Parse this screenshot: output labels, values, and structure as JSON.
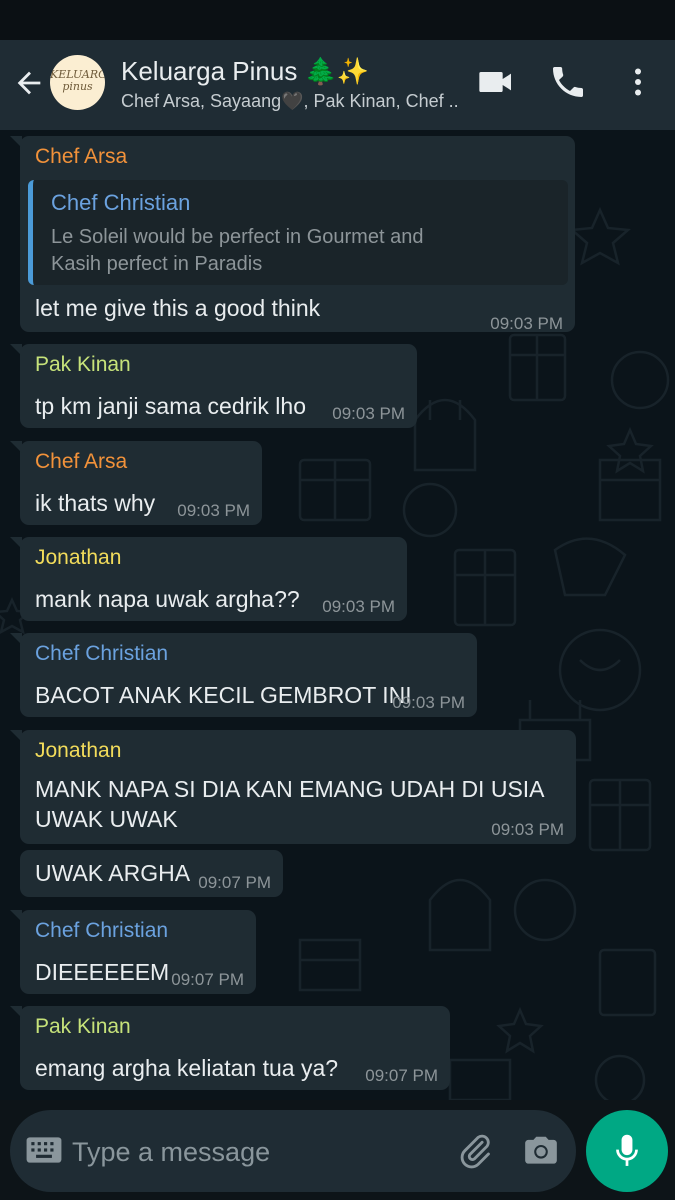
{
  "header": {
    "title": "Keluarga Pinus 🌲✨",
    "subtitle": "Chef Arsa, Sayaang🖤, Pak Kinan, Chef ..",
    "avatar_text": "KELUARGA pinus",
    "back_icon": "arrow-left-icon",
    "video_icon": "video-call-icon",
    "call_icon": "phone-icon",
    "menu_icon": "more-vert-icon"
  },
  "colors": {
    "header_bg": "#1f2c34",
    "chat_bg": "#0b141a",
    "bubble_bg": "#1f2c33",
    "accent": "#00a884",
    "sender_orange": "#f2923a",
    "sender_green": "#c6e27a",
    "sender_yellow": "#f2dc5b",
    "sender_blue": "#6ba2df"
  },
  "messages": [
    {
      "sender": "Chef Arsa",
      "quote": {
        "sender": "Chef Christian",
        "text": "Le Soleil would be perfect in Gourmet and Kasih perfect in Paradis"
      },
      "text": "let me give this a good think",
      "time": "09:03 PM"
    },
    {
      "sender": "Pak Kinan",
      "text": "tp km janji sama cedrik lho",
      "time": "09:03 PM"
    },
    {
      "sender": "Chef Arsa",
      "text": "ik thats why",
      "time": "09:03 PM"
    },
    {
      "sender": "Jonathan",
      "text": "mank napa uwak argha??",
      "time": "09:03 PM"
    },
    {
      "sender": "Chef Christian",
      "text": "BACOT ANAK KECIL GEMBROT INI",
      "time": "09:03 PM"
    },
    {
      "sender": "Jonathan",
      "text": "MANK NAPA SI DIA KAN EMANG UDAH DI USIA UWAK UWAK",
      "time": "09:03 PM"
    },
    {
      "sender": "",
      "text": "UWAK ARGHA",
      "time": "09:07 PM"
    },
    {
      "sender": "Chef Christian",
      "text": "DIEEEEEEM",
      "time": "09:07 PM"
    },
    {
      "sender": "Pak Kinan",
      "text": "emang argha keliatan tua ya?",
      "time": "09:07 PM"
    }
  ],
  "composer": {
    "placeholder": "Type a message",
    "keyboard_icon": "keyboard-icon",
    "attach_icon": "paperclip-icon",
    "camera_icon": "camera-icon",
    "mic_icon": "mic-icon"
  },
  "scroll_icon": "double-chevron-down-icon"
}
